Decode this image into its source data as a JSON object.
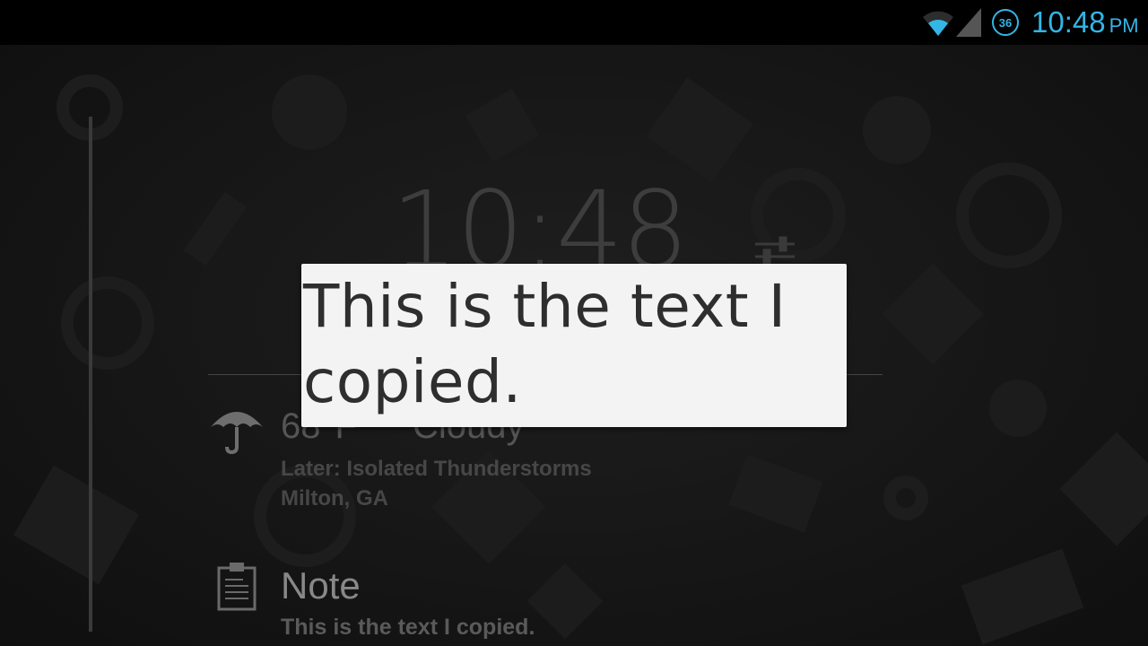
{
  "status_bar": {
    "battery_level": "36",
    "time": "10:48",
    "ampm": "PM",
    "accent_color": "#33b5e5",
    "icons": [
      "wifi-icon",
      "cell-signal-icon",
      "battery-circle-icon"
    ]
  },
  "lockscreen": {
    "clock": "10:48",
    "weather": {
      "temperature": "68°F",
      "condition": "Cloudy",
      "later": "Later: Isolated Thunderstorms",
      "location": "Milton, GA",
      "icon": "umbrella-icon"
    },
    "note": {
      "title": "Note",
      "body": "This is the text I copied.",
      "icon": "clipboard-icon"
    }
  },
  "clipboard_popup": {
    "text": "This is the text I copied."
  }
}
